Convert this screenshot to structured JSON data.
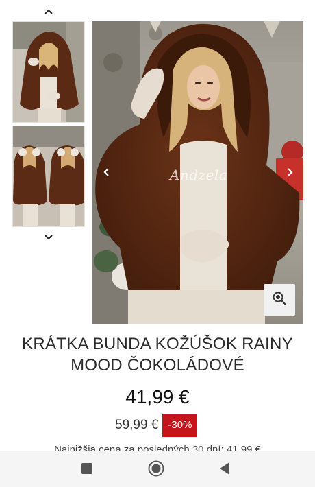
{
  "gallery": {
    "main_watermark": "Andzela",
    "thumbnails": [
      {
        "label": "thumbnail-1"
      },
      {
        "label": "thumbnail-2"
      }
    ]
  },
  "product": {
    "title": "KRÁTKA BUNDA KOŽÚŠOK RAINY MOOD ČOKOLÁDOVÉ",
    "price": "41,99 €",
    "old_price": "59,99 €",
    "discount": "-30%",
    "lowest_price_note": "Najnižšia cena za posledných 30 dní: 41,99 €"
  },
  "colors": {
    "discount_bg": "#c4151c",
    "fur": "#5a2a14",
    "navbar_bg": "#f5f5f5"
  },
  "icons": {
    "thumb_up": "chevron-up-icon",
    "thumb_down": "chevron-down-icon",
    "prev": "chevron-left-icon",
    "next": "chevron-right-icon",
    "zoom": "zoom-in-icon",
    "recent": "recent-apps-icon",
    "home": "home-icon",
    "back": "back-icon"
  }
}
